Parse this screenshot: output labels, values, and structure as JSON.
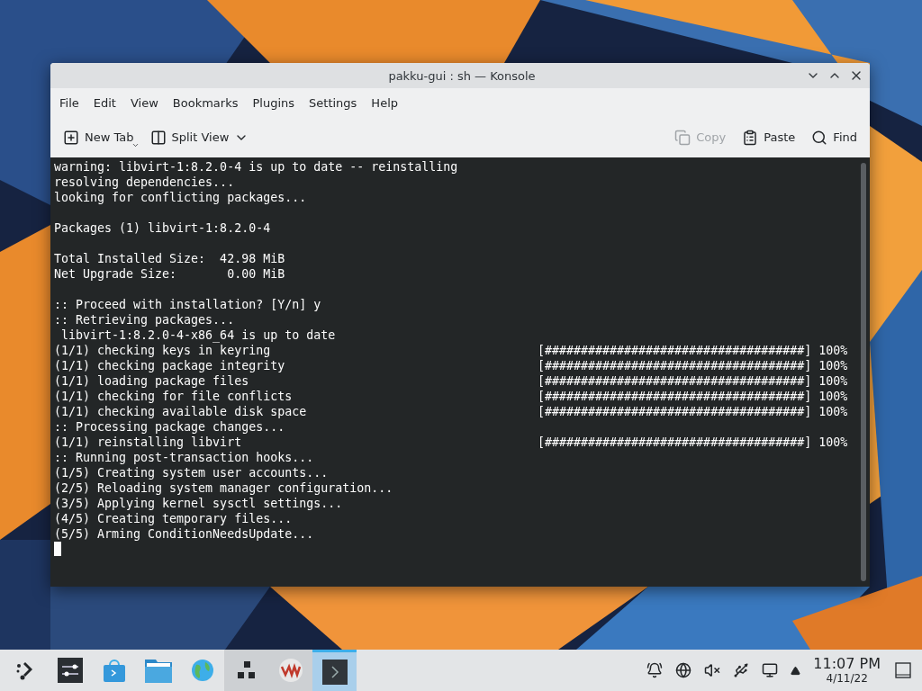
{
  "window": {
    "title": "pakku-gui : sh — Konsole"
  },
  "menu": [
    "File",
    "Edit",
    "View",
    "Bookmarks",
    "Plugins",
    "Settings",
    "Help"
  ],
  "toolbar": [
    {
      "kind": "newtab",
      "label": "New Tab",
      "disabled": false
    },
    {
      "kind": "split",
      "label": "Split View",
      "disabled": false
    },
    {
      "kind": "copy",
      "label": "Copy",
      "disabled": true
    },
    {
      "kind": "paste",
      "label": "Paste",
      "disabled": false
    },
    {
      "kind": "find",
      "label": "Find",
      "disabled": false
    }
  ],
  "terminal": {
    "lines": [
      {
        "text": "warning: libvirt-1:8.2.0-4 is up to date -- reinstalling"
      },
      {
        "text": "resolving dependencies..."
      },
      {
        "text": "looking for conflicting packages..."
      },
      {
        "kind": "blank"
      },
      {
        "text": "Packages (1) libvirt-1:8.2.0-4"
      },
      {
        "kind": "blank"
      },
      {
        "text": "Total Installed Size:  42.98 MiB"
      },
      {
        "text": "Net Upgrade Size:       0.00 MiB"
      },
      {
        "kind": "blank"
      },
      {
        "text": ":: Proceed with installation? [Y/n] y"
      },
      {
        "text": ":: Retrieving packages..."
      },
      {
        "text": " libvirt-1:8.2.0-4-x86_64 is up to date"
      },
      {
        "text": "(1/1) checking keys in keyring",
        "progress": "[####################################] 100%"
      },
      {
        "text": "(1/1) checking package integrity",
        "progress": "[####################################] 100%"
      },
      {
        "text": "(1/1) loading package files",
        "progress": "[####################################] 100%"
      },
      {
        "text": "(1/1) checking for file conflicts",
        "progress": "[####################################] 100%"
      },
      {
        "text": "(1/1) checking available disk space",
        "progress": "[####################################] 100%"
      },
      {
        "text": ":: Processing package changes..."
      },
      {
        "text": "(1/1) reinstalling libvirt",
        "progress": "[####################################] 100%"
      },
      {
        "text": ":: Running post-transaction hooks..."
      },
      {
        "text": "(1/5) Creating system user accounts..."
      },
      {
        "text": "(2/5) Reloading system manager configuration..."
      },
      {
        "text": "(3/5) Applying kernel sysctl settings..."
      },
      {
        "text": "(4/5) Creating temporary files..."
      },
      {
        "text": "(5/5) Arming ConditionNeedsUpdate..."
      },
      {
        "kind": "cursor"
      }
    ]
  },
  "taskbar": {
    "items": [
      {
        "kind": "launcher",
        "selected": false
      },
      {
        "kind": "settings",
        "selected": false
      },
      {
        "kind": "store",
        "selected": false
      },
      {
        "kind": "folder",
        "selected": false
      },
      {
        "kind": "globe",
        "selected": false
      },
      {
        "kind": "pager",
        "selected": false
      },
      {
        "kind": "vm",
        "selected": false
      },
      {
        "kind": "terminal",
        "selected": true
      }
    ],
    "tray": [
      {
        "kind": "bell"
      },
      {
        "kind": "network"
      },
      {
        "kind": "mute"
      },
      {
        "kind": "usb"
      },
      {
        "kind": "display"
      },
      {
        "kind": "expand"
      }
    ],
    "time": "11:07 PM",
    "date": "4/11/22"
  }
}
